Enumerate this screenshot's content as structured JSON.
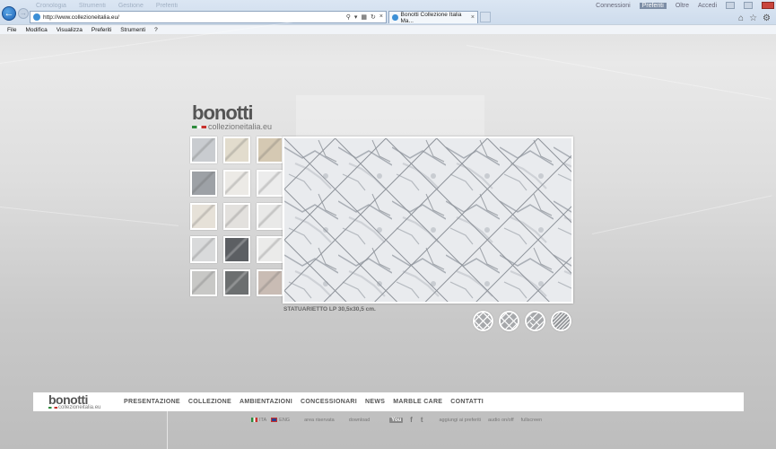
{
  "browser": {
    "url": "http://www.collezioneitalia.eu/",
    "tab_title": "Bonotti Collezione Italia Ma...",
    "faded_menu": [
      "Cronologia",
      "Strumenti",
      "Gestione",
      "Preferiti"
    ],
    "right_labels": [
      "Connessioni",
      "Preferiti",
      "Oltre",
      "Accedi"
    ],
    "menu": [
      "File",
      "Modifica",
      "Visualizza",
      "Preferiti",
      "Strumenti",
      "?"
    ]
  },
  "site": {
    "logo_brand": "bonotti",
    "logo_sub": "collezioneitalia.eu",
    "caption": "STATUARIETTO LP 30,5x30,5 cm.",
    "thumb_colors": [
      "#c9ccd0",
      "#e2dccd",
      "#d5c9b3",
      "#9da1a6",
      "#eceae6",
      "#ececec",
      "#e6e1d8",
      "#e3e1de",
      "#e9e9e8",
      "#d9dadb",
      "#5c5f63",
      "#ebebea",
      "#c8c8c6",
      "#6c6f70",
      "#c9bcb4"
    ],
    "nav": [
      "PRESENTAZIONE",
      "COLLEZIONE",
      "AMBIENTAZIONI",
      "CONCESSIONARI",
      "NEWS",
      "MARBLE CARE",
      "CONTATTI"
    ],
    "lang_ita": "ITA",
    "lang_eng": "ENG",
    "area_riservata": "area riservata",
    "download": "download",
    "youtube": "You",
    "facebook": "f",
    "twitter": "t",
    "aggiungi": "aggiungi ai preferiti",
    "audio": "audio on/off",
    "fullscreen": "fullscreen"
  }
}
